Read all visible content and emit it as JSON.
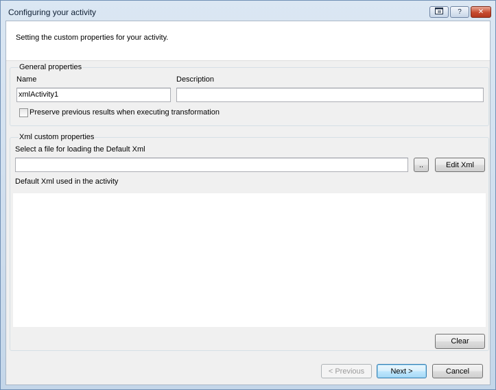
{
  "window": {
    "title": "Configuring your activity",
    "titlebar_buttons": [
      "restore-icon",
      "help-icon",
      "close-icon"
    ]
  },
  "header": {
    "text": "Setting the custom properties for your activity."
  },
  "general": {
    "title": "General properties",
    "name_label": "Name",
    "name_value": "xmlActivity1",
    "description_label": "Description",
    "description_value": "",
    "preserve_label": "Preserve previous results when executing transformation",
    "preserve_checked": false
  },
  "xml": {
    "title": "Xml custom properties",
    "select_label": "Select a file for loading the Default Xml",
    "file_value": "",
    "browse_label": "..",
    "edit_label": "Edit Xml",
    "default_label": "Default Xml used in the activity",
    "default_content": "",
    "clear_label": "Clear"
  },
  "footer": {
    "previous_label": "< Previous",
    "next_label": "Next >",
    "cancel_label": "Cancel"
  }
}
